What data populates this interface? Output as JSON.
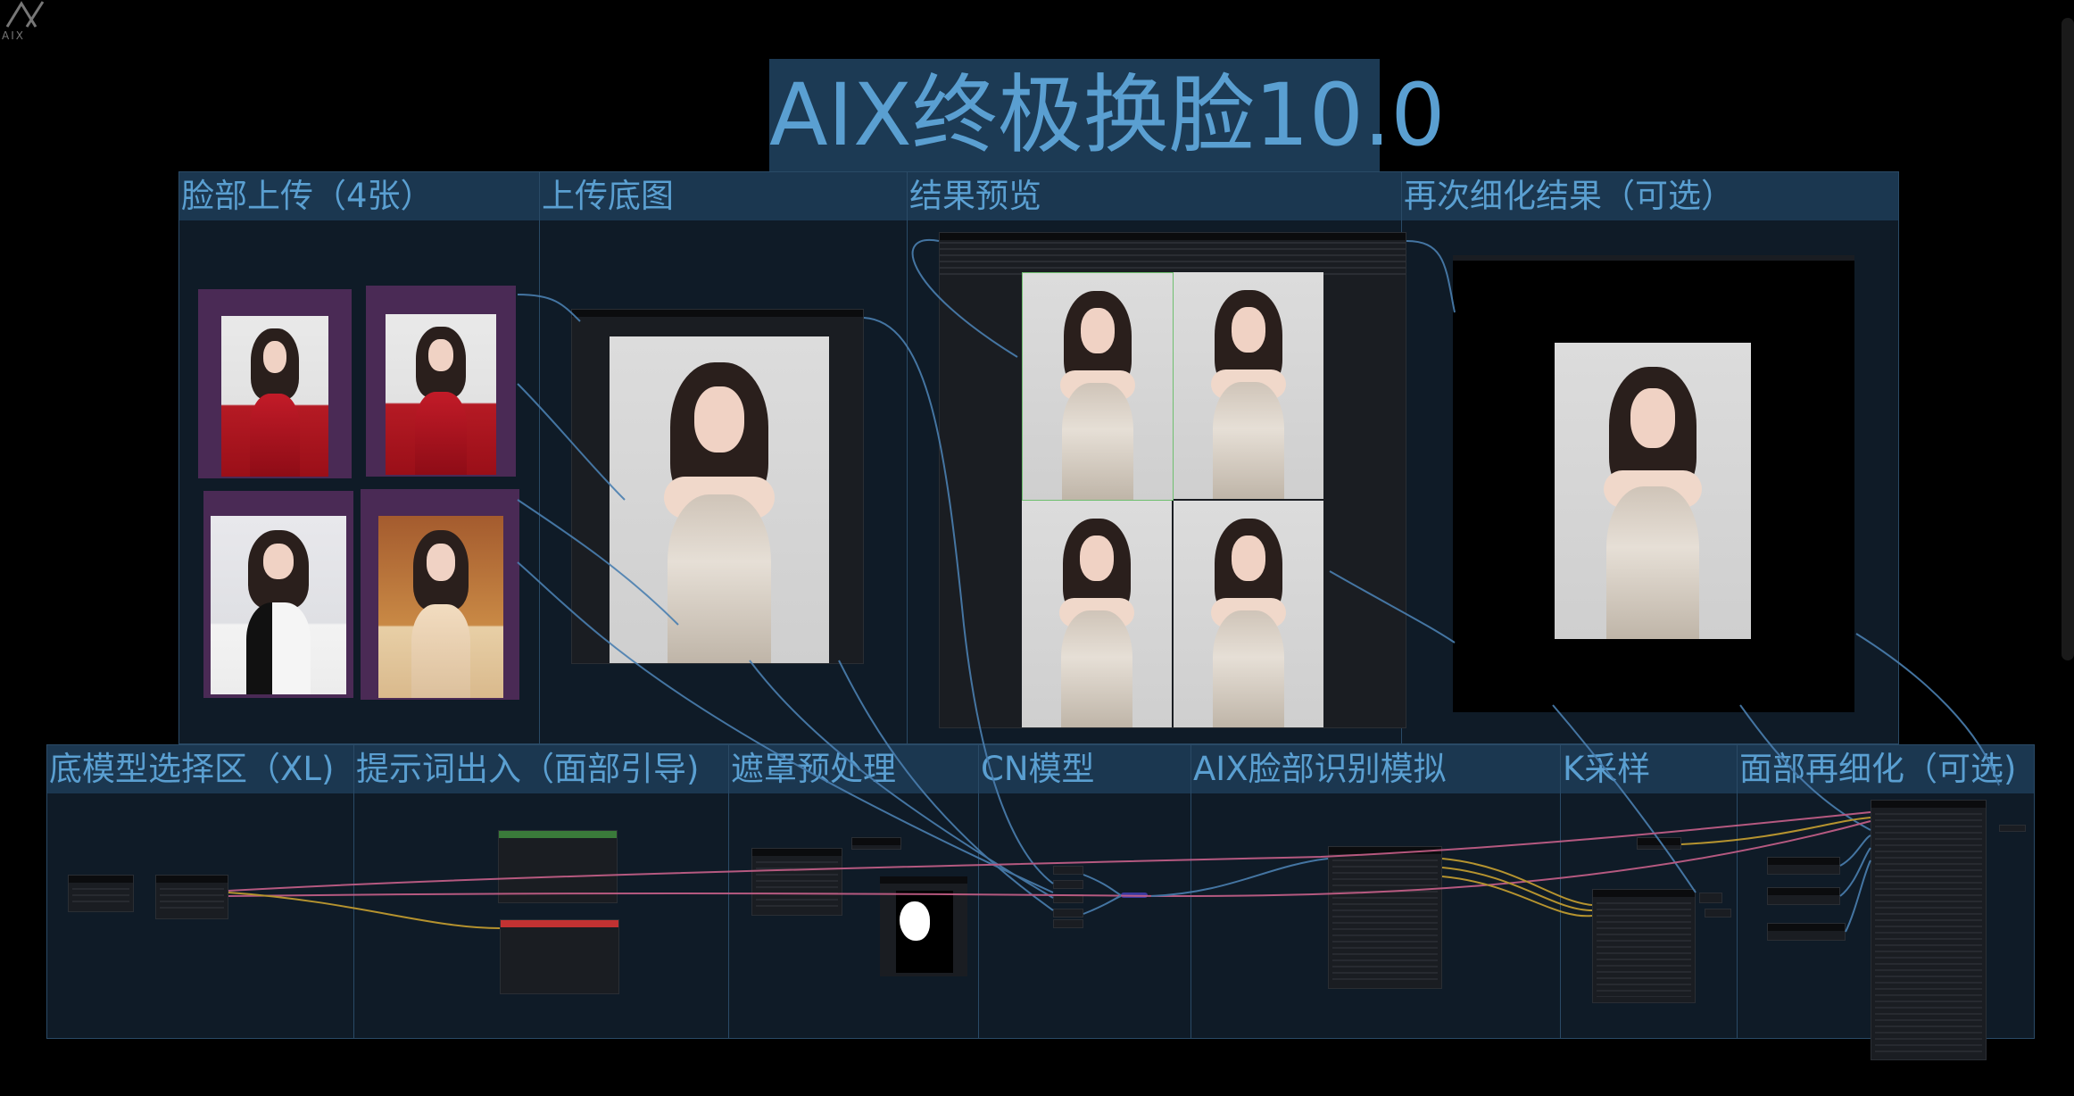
{
  "app": {
    "logo_text": "AIX"
  },
  "title": "AIX终极换脸10.0",
  "groups": {
    "face_upload": "脸部上传（4张）",
    "base_upload": "上传底图",
    "result_preview": "结果预览",
    "refine_result": "再次细化结果（可选）",
    "model_select": "底模型选择区（XL)",
    "prompt_input": "提示词出入（面部引导)",
    "mask_preprocess": "遮罩预处理",
    "cn_model": "CN模型",
    "face_recognition": "AIX脸部识别模拟",
    "k_sampler": "K采样",
    "face_refine": "面部再细化（可选)"
  },
  "colors": {
    "canvas": "#000000",
    "group_header": "#1b3750",
    "group_body": "#0f1b27",
    "group_text": "#5a9fd1",
    "node_purple": "#4a2a55",
    "positive_bar": "#3a7a3a",
    "negative_bar": "#c23232",
    "wire_blue": "#4a7fb0",
    "wire_pink": "#c8608a",
    "wire_yellow": "#c8a030"
  }
}
